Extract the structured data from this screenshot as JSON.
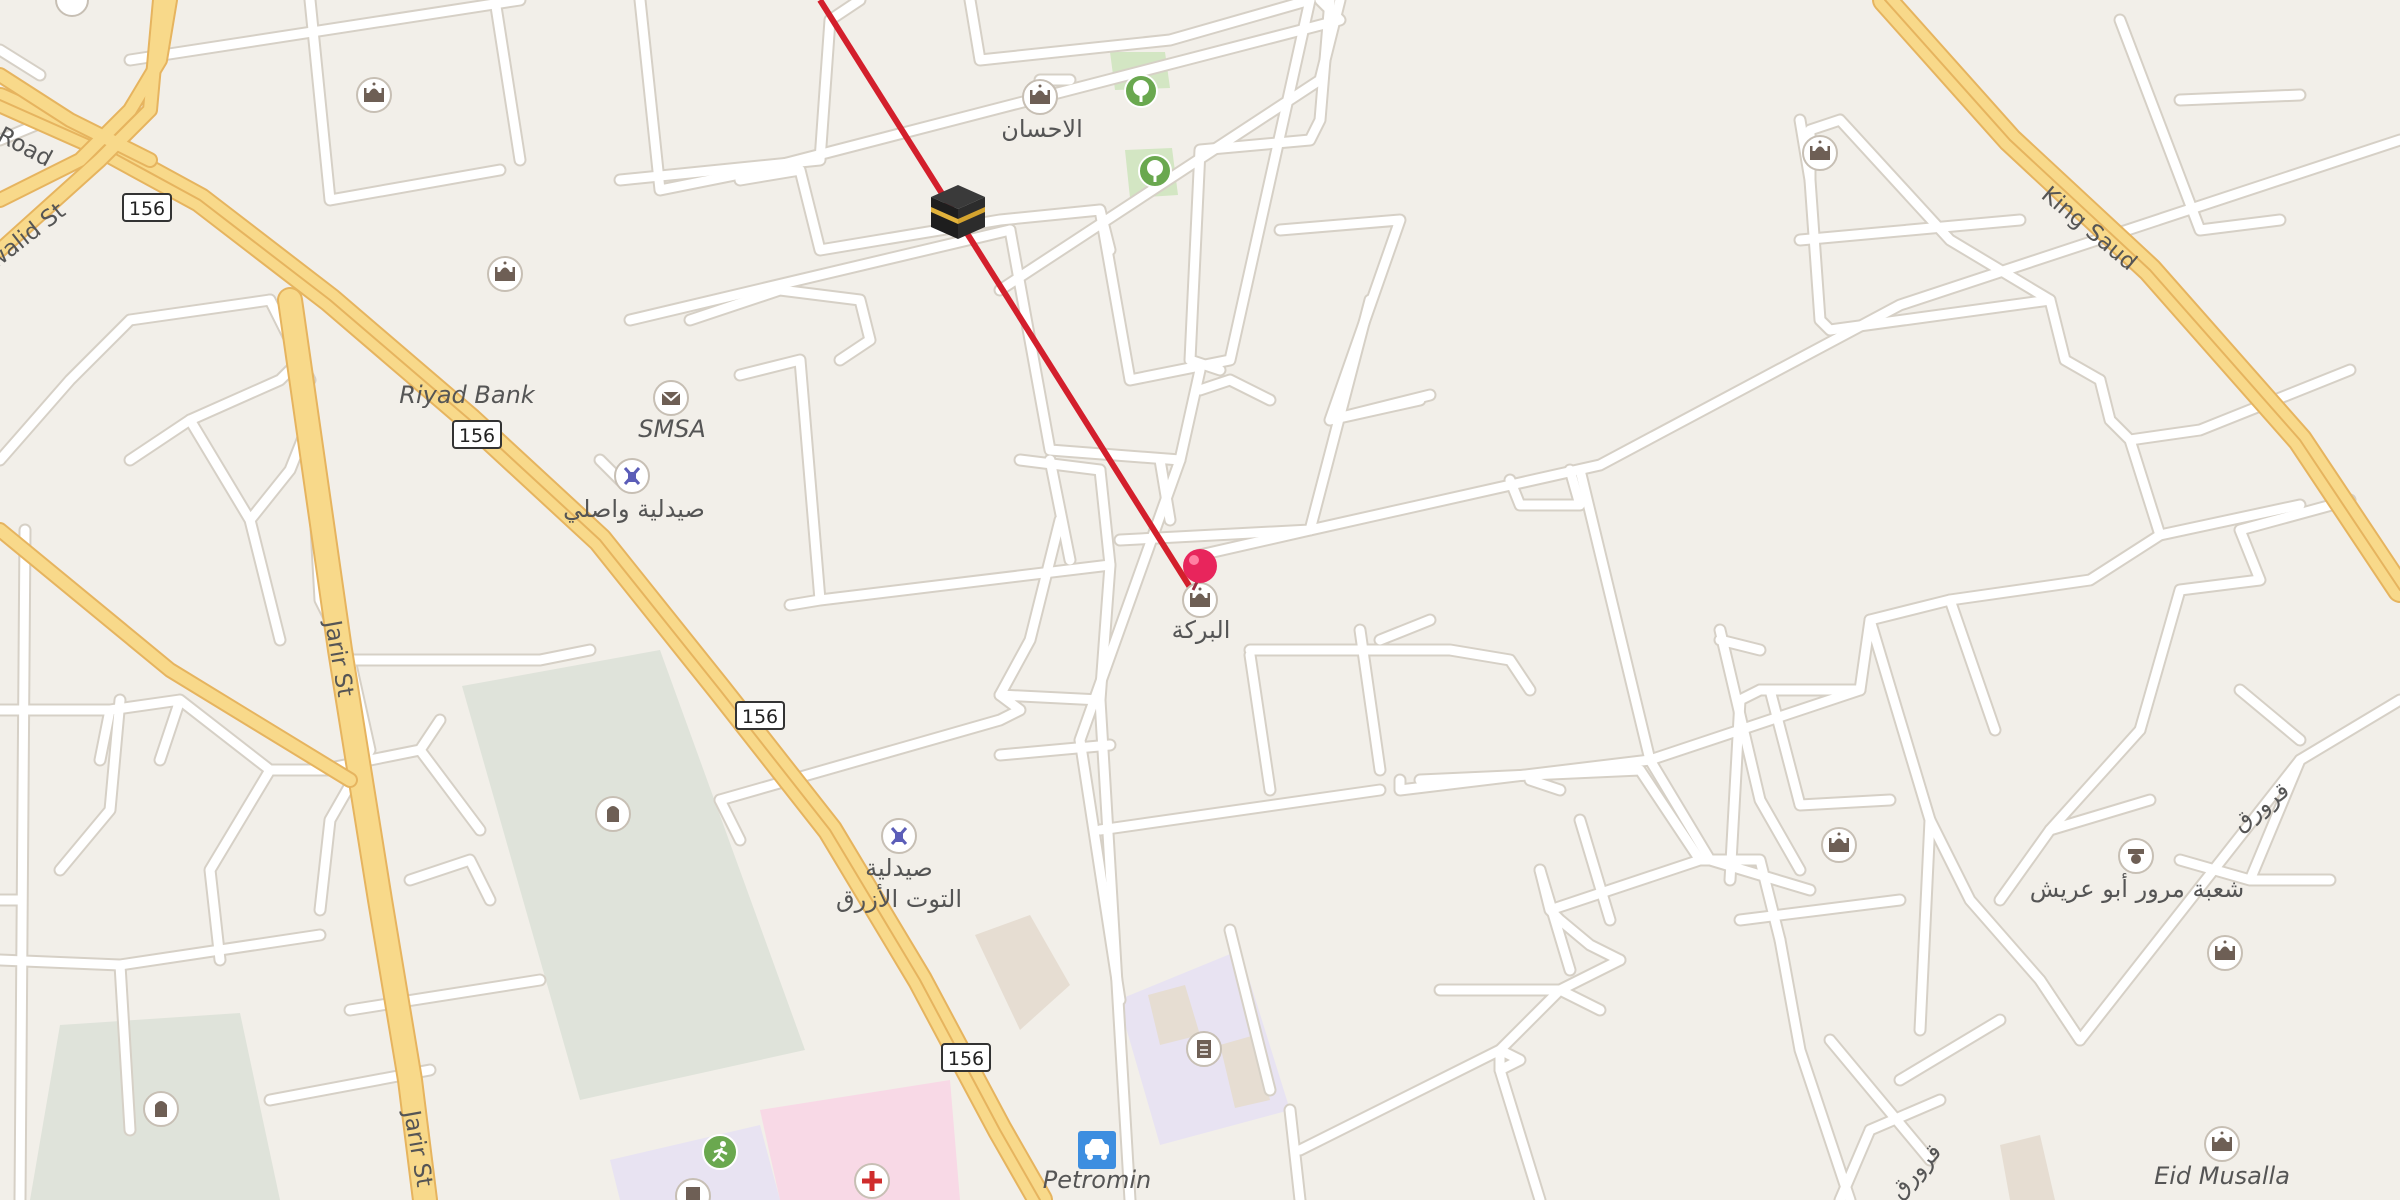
{
  "map": {
    "colors": {
      "background": "#f2efe9",
      "street": "#ffffff",
      "street_casing": "#d6d0c6",
      "major_road": "#f8d98a",
      "major_road_casing": "#e6b45f",
      "route_line": "#d31f2c",
      "pin": "#e8255c",
      "poi_icon": "#6e5f55",
      "park": "#d3e6c3",
      "cemetery": "#dfe3da",
      "label": "#555555"
    },
    "road_labels": {
      "jarir_1": "Jarir St",
      "jarir_2": "Jarir St",
      "king_saud": "King Saud",
      "road_top_left": "Road",
      "walid": "walid St",
      "arabic_1": "قرورق",
      "arabic_2": "قرورق"
    },
    "shields": {
      "s1": "156",
      "s2": "156",
      "s3": "156",
      "s4": "156"
    },
    "places": {
      "alihsan": "الاحسان",
      "riyad_bank": "Riyad Bank",
      "smsa": "SMSA",
      "pharmacy_wasli": "صيدلية واصلي",
      "albaraka": "البركة",
      "pharmacy_tut_line1": "صيدلية",
      "pharmacy_tut_line2": "التوت الأزرق",
      "traffic_office": "شعبة مرور أبو عريش",
      "petromin": "Petromin",
      "eid_musalla": "Eid Musalla"
    },
    "icons": {
      "kaaba": "kaaba-icon",
      "pin": "map-pin-icon",
      "mosque": "mosque-icon",
      "pharmacy": "pharmacy-icon",
      "post": "post-office-icon",
      "cemetery": "cemetery-icon",
      "park": "tree-icon",
      "fuel": "fuel-station-icon",
      "police": "police-icon",
      "hospital": "hospital-icon",
      "sports": "sports-icon",
      "school": "school-icon"
    }
  }
}
